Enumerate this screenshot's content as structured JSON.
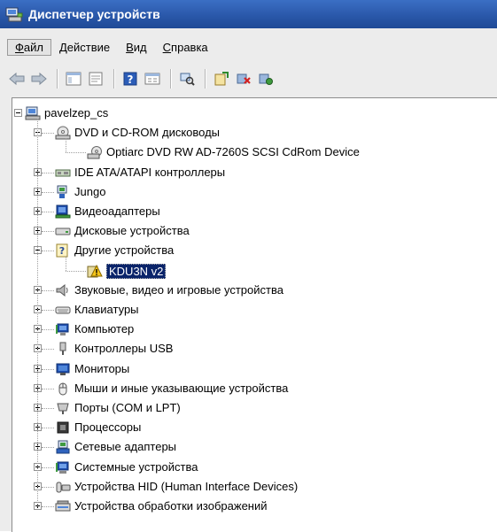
{
  "window": {
    "title": "Диспетчер устройств"
  },
  "menu": [
    {
      "prefix": "",
      "u": "Ф",
      "rest": "айл"
    },
    {
      "prefix": "",
      "u": "Д",
      "rest": "ействие"
    },
    {
      "prefix": "",
      "u": "В",
      "rest": "ид"
    },
    {
      "prefix": "",
      "u": "С",
      "rest": "правка"
    }
  ],
  "toolbar": [
    "back-icon",
    "forward-icon",
    "console-tree-icon",
    "properties-icon",
    "help-icon",
    "view-icon",
    "scan-hardware-icon",
    "update-driver-icon",
    "uninstall-icon",
    "disable-icon"
  ],
  "tree": {
    "root": "pavelzep_cs",
    "nodes": [
      {
        "label": "DVD и CD-ROM дисководы",
        "icon": "dvd-drive-icon",
        "expanded": true,
        "children": [
          {
            "label": "Optiarc DVD RW AD-7260S SCSI CdRom Device",
            "icon": "cdrom-device-icon"
          }
        ]
      },
      {
        "label": "IDE ATA/ATAPI контроллеры",
        "icon": "ide-controller-icon",
        "expanded": false
      },
      {
        "label": "Jungo",
        "icon": "jungo-icon",
        "expanded": false
      },
      {
        "label": "Видеоадаптеры",
        "icon": "display-adapter-icon",
        "expanded": false
      },
      {
        "label": "Дисковые устройства",
        "icon": "disk-drive-icon",
        "expanded": false
      },
      {
        "label": "Другие устройства",
        "icon": "other-devices-icon",
        "expanded": true,
        "children": [
          {
            "label": "KDU3N v2",
            "icon": "unknown-device-warning-icon",
            "selected": true
          }
        ]
      },
      {
        "label": "Звуковые, видео и игровые устройства",
        "icon": "sound-icon",
        "expanded": false
      },
      {
        "label": "Клавиатуры",
        "icon": "keyboard-icon",
        "expanded": false
      },
      {
        "label": "Компьютер",
        "icon": "computer-icon",
        "expanded": false
      },
      {
        "label": "Контроллеры USB",
        "icon": "usb-icon",
        "expanded": false
      },
      {
        "label": "Мониторы",
        "icon": "monitor-icon",
        "expanded": false
      },
      {
        "label": "Мыши и иные указывающие устройства",
        "icon": "mouse-icon",
        "expanded": false
      },
      {
        "label": "Порты (COM и LPT)",
        "icon": "port-icon",
        "expanded": false
      },
      {
        "label": "Процессоры",
        "icon": "processor-icon",
        "expanded": false
      },
      {
        "label": "Сетевые адаптеры",
        "icon": "network-adapter-icon",
        "expanded": false
      },
      {
        "label": "Системные устройства",
        "icon": "system-device-icon",
        "expanded": false
      },
      {
        "label": "Устройства HID (Human Interface Devices)",
        "icon": "hid-icon",
        "expanded": false
      },
      {
        "label": "Устройства обработки изображений",
        "icon": "imaging-device-icon",
        "expanded": false
      }
    ]
  }
}
